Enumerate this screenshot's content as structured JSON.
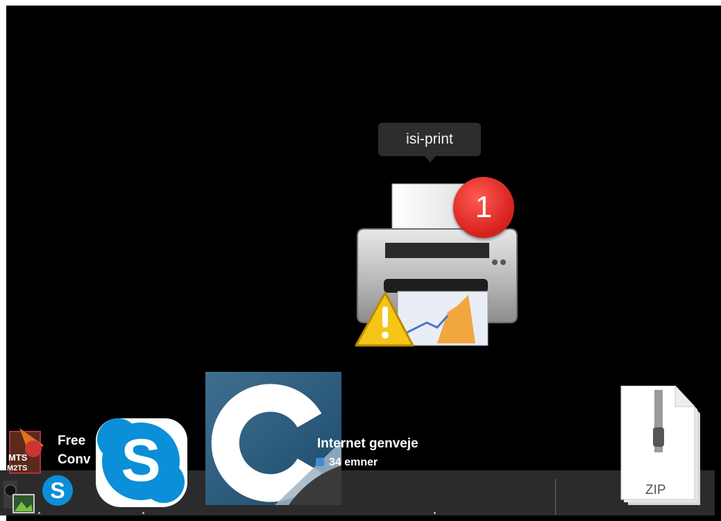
{
  "tooltip": {
    "text": "isi-print"
  },
  "printer": {
    "badge_count": "1"
  },
  "stack_left": {
    "title_line1": "Free",
    "title_line1_suffix": "S",
    "title_line2": "Conv"
  },
  "stack_right": {
    "title": "Internet genveje",
    "count": "34 emner"
  },
  "zip": {
    "label": "ZIP"
  },
  "mts_icon": {
    "line1": "MTS",
    "line2": "M2TS"
  },
  "colors": {
    "background": "#000000",
    "dock": "#2b2b2b",
    "badge": "#e0251e",
    "skype": "#0a8fd8"
  }
}
